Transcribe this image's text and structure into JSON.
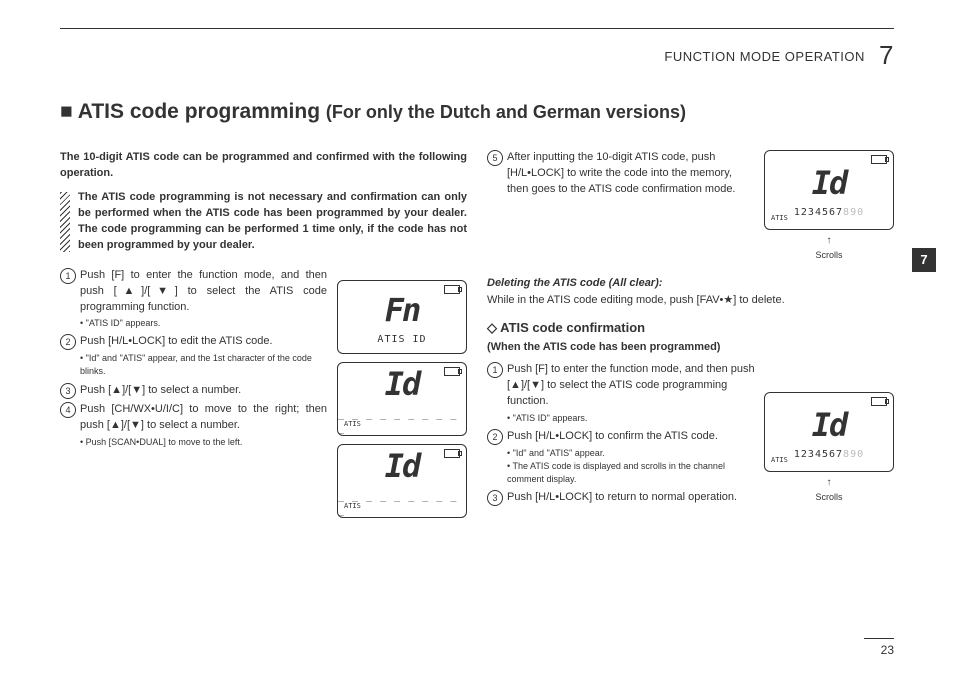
{
  "header": {
    "section": "FUNCTION MODE OPERATION",
    "chapter": "7"
  },
  "title": {
    "main": "■ ATIS code programming",
    "sub": "(For only the Dutch and German versions)"
  },
  "left": {
    "intro": "The 10-digit ATIS code can be programmed and confirmed with the following operation.",
    "note": "The ATIS code programming is not necessary and confirmation can only be performed when the ATIS code has been programmed by your dealer. The code programming can be performed 1 time only, if the code has not been programmed by your dealer.",
    "steps": [
      {
        "n": "1",
        "t": "Push [F] to enter the function mode, and then push [▲]/[▼] to select the ATIS code programming function.",
        "s": "• \"ATIS ID\" appears."
      },
      {
        "n": "2",
        "t": "Push [H/L•LOCK] to edit the ATIS code.",
        "s": "• \"Id\" and \"ATIS\" appear, and the 1st character of the code blinks."
      },
      {
        "n": "3",
        "t": "Push [▲]/[▼] to select a number."
      },
      {
        "n": "4",
        "t": "Push [CH/WX•U/I/C] to move to the right; then push [▲]/[▼] to select a number.",
        "s": "• Push [SCAN•DUAL] to move to the left."
      }
    ],
    "lcds": [
      {
        "big": "Fn",
        "small": "ATIS ID"
      },
      {
        "big": "Id",
        "small": "_ _ _ _ _ _ _ _ _ _",
        "atis": "ATIS"
      },
      {
        "big": "Id",
        "small": "_ _ _ _ _ _ _ _ _ _",
        "atis": "ATIS"
      }
    ]
  },
  "right": {
    "step5": {
      "n": "5",
      "t": "After inputting the 10-digit ATIS code, push [H/L•LOCK] to write the code into the memory, then goes to the ATIS code confirmation mode."
    },
    "lcd_top": {
      "big": "Id",
      "digits": "1234567",
      "digits_dim": "890",
      "atis": "ATIS",
      "scrolls": "Scrolls"
    },
    "del_hdr": "Deleting the ATIS code (All clear):",
    "del_txt": "While in the ATIS code editing mode, push [FAV•★] to delete.",
    "conf_hdr": "ATIS code confirmation",
    "conf_sub": "(When the ATIS code has been programmed)",
    "conf_steps": [
      {
        "n": "1",
        "t": "Push [F] to enter the function mode, and then push [▲]/[▼] to select the ATIS code programming function.",
        "s": "• \"ATIS ID\" appears."
      },
      {
        "n": "2",
        "t": "Push [H/L•LOCK] to confirm the ATIS code.",
        "s": "• \"Id\" and \"ATIS\" appear.\n• The ATIS code is displayed and scrolls in the channel comment display."
      },
      {
        "n": "3",
        "t": "Push [H/L•LOCK] to return to normal operation."
      }
    ],
    "lcd_bottom": {
      "big": "Id",
      "digits": "1234567",
      "digits_dim": "890",
      "atis": "ATIS",
      "scrolls": "Scrolls"
    }
  },
  "sidetab": "7",
  "pagefoot": "23"
}
